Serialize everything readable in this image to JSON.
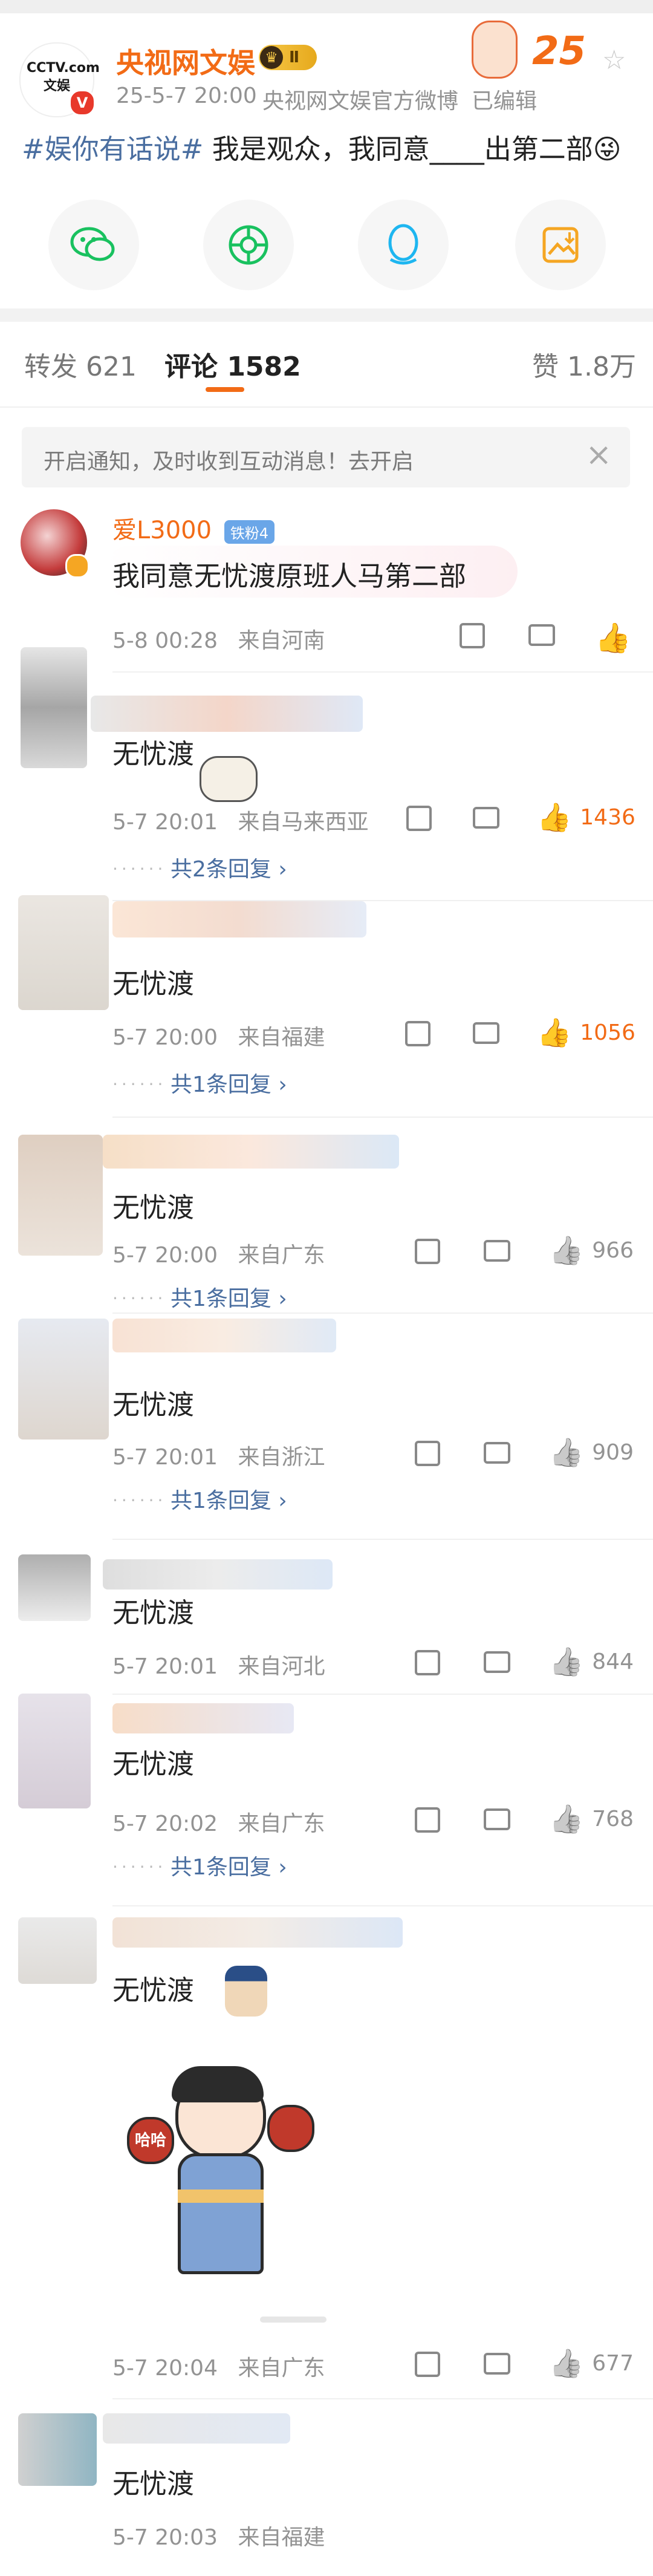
{
  "post": {
    "author": "央视网文娱",
    "logo_text": "CCTV.com 文娱",
    "rank_badge": "Ⅱ",
    "time": "25-5-7 20:00",
    "source": "央视网文娱官方微博",
    "edited": "已编辑",
    "hashtag": "#娱你有话说#",
    "body": " 我是观众，我同意____出第二部",
    "emoji": "😜",
    "event_badge": "25"
  },
  "share": [
    {
      "icon": "wechat-icon"
    },
    {
      "icon": "moments-icon"
    },
    {
      "icon": "qq-icon"
    },
    {
      "icon": "save-image-icon"
    }
  ],
  "tabs": {
    "repost": "转发 621",
    "comment": "评论 1582",
    "like": "赞 1.8万"
  },
  "notice": {
    "text": "开启通知，及时收到互动消息！去开启",
    "close": "×"
  },
  "comments": [
    {
      "name": "爱L3000",
      "badge": "铁粉4",
      "text": "我同意无忧渡原班人马第二部",
      "time": "5-8 00:28",
      "location": "来自河南",
      "likes": "",
      "replies": ""
    },
    {
      "name": "",
      "badge": "",
      "text": "无忧渡",
      "time": "5-7 20:01",
      "location": "来自马来西亚",
      "likes": "1436",
      "replies": "共2条回复 ›"
    },
    {
      "name": "",
      "badge": "",
      "text": "无忧渡",
      "time": "5-7 20:00",
      "location": "来自福建",
      "likes": "1056",
      "replies": "共1条回复 ›"
    },
    {
      "name": "",
      "badge": "",
      "text": "无忧渡",
      "time": "5-7 20:00",
      "location": "来自广东",
      "likes": "966",
      "replies": "共1条回复 ›"
    },
    {
      "name": "",
      "badge": "",
      "text": "无忧渡",
      "time": "5-7 20:01",
      "location": "来自浙江",
      "likes": "909",
      "replies": "共1条回复 ›"
    },
    {
      "name": "",
      "badge": "",
      "text": "无忧渡",
      "time": "5-7 20:01",
      "location": "来自河北",
      "likes": "844",
      "replies": ""
    },
    {
      "name": "",
      "badge": "",
      "text": "无忧渡",
      "time": "5-7 20:02",
      "location": "来自广东",
      "likes": "768",
      "replies": "共1条回复 ›"
    },
    {
      "name": "",
      "badge": "",
      "text": "无忧渡",
      "time": "5-7 20:04",
      "location": "来自广东",
      "likes": "677",
      "replies": "",
      "sticker_text": "哈哈哈"
    },
    {
      "name": "",
      "badge": "",
      "text": "无忧渡",
      "time": "5-7 20:03",
      "location": "来自福建",
      "likes": "",
      "replies": ""
    }
  ],
  "colors": {
    "accent": "#f26b16",
    "link": "#4a6ea0",
    "muted": "#939393"
  }
}
